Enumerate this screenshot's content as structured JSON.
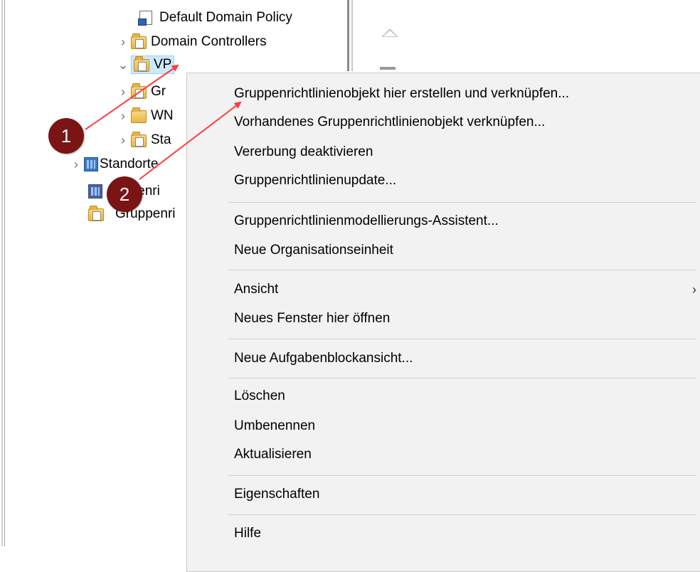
{
  "tree": {
    "items": [
      {
        "label": "Default Domain Policy",
        "icon": "gpo-link-icon"
      },
      {
        "label": "Domain Controllers",
        "icon": "ou-folder-icon",
        "expander": "collapsed"
      },
      {
        "label": "VP",
        "icon": "ou-folder-icon",
        "expander": "expanded",
        "selected": true
      },
      {
        "label": "Gr",
        "icon": "folder-icon",
        "expander": "collapsed"
      },
      {
        "label": "WN",
        "icon": "wmi-filter-folder-icon",
        "expander": "collapsed"
      },
      {
        "label": "Sta",
        "icon": "starter-gpo-folder-icon",
        "expander": "collapsed"
      },
      {
        "label": "Standorte",
        "icon": "sites-icon",
        "expander": "collapsed"
      },
      {
        "label": "ppenri",
        "icon": "gpo-modeling-icon"
      },
      {
        "label": "Gruppenri",
        "icon": "gpo-results-icon"
      }
    ]
  },
  "context_menu": {
    "groups": [
      [
        {
          "label": "Gruppenrichtlinienobjekt hier erstellen und verknüpfen..."
        },
        {
          "label": "Vorhandenes Gruppenrichtlinienobjekt verknüpfen..."
        },
        {
          "label": "Vererbung deaktivieren"
        },
        {
          "label": "Gruppenrichtlinienupdate..."
        }
      ],
      [
        {
          "label": "Gruppenrichtlinienmodellierungs-Assistent..."
        },
        {
          "label": "Neue Organisationseinheit"
        }
      ],
      [
        {
          "label": "Ansicht",
          "submenu_arrow": "›"
        },
        {
          "label": "Neues Fenster hier öffnen"
        }
      ],
      [
        {
          "label": "Neue Aufgabenblockansicht..."
        }
      ],
      [
        {
          "label": "Löschen"
        },
        {
          "label": "Umbenennen"
        },
        {
          "label": "Aktualisieren"
        }
      ],
      [
        {
          "label": "Eigenschaften"
        }
      ],
      [
        {
          "label": "Hilfe"
        }
      ]
    ]
  },
  "callouts": {
    "one": "1",
    "two": "2",
    "color": "#7b1414",
    "arrow_color": "#ff3b3b"
  },
  "colors": {
    "selection_bg": "#cce8ff",
    "menu_bg": "#f2f2f2"
  }
}
